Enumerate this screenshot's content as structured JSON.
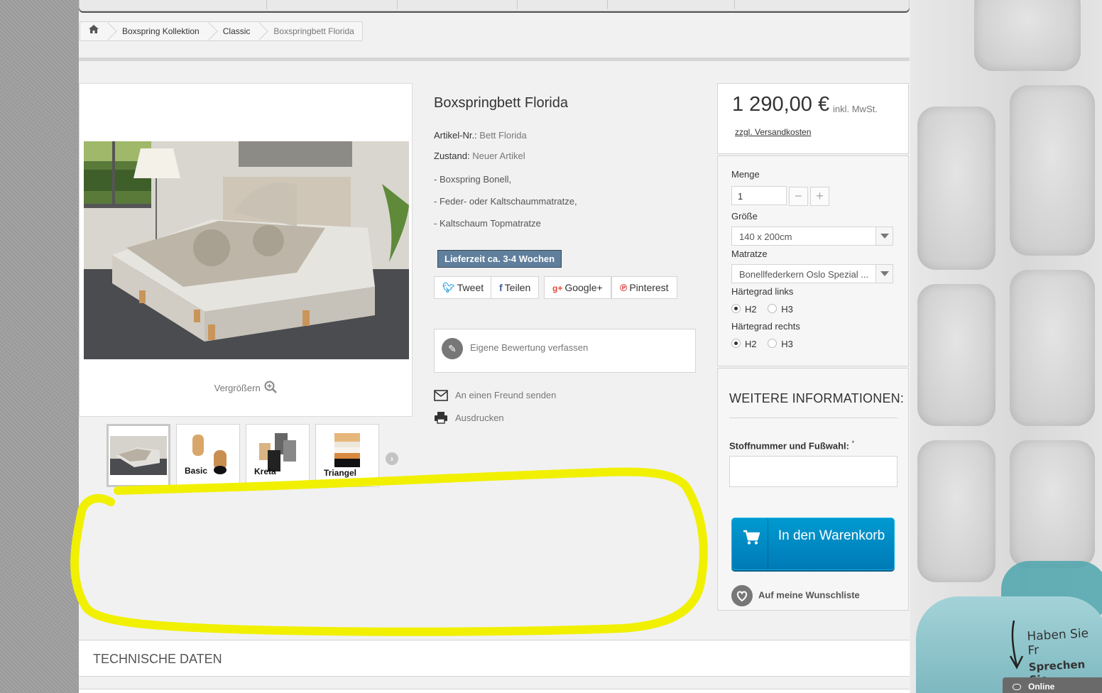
{
  "breadcrumb": {
    "home_icon": "home-icon",
    "items": [
      "Boxspring Kollektion",
      "Classic",
      "Boxspringbett Florida"
    ]
  },
  "product": {
    "title": "Boxspringbett Florida",
    "reference_label": "Artikel-Nr.:",
    "reference_value": "Bett Florida",
    "condition_label": "Zustand:",
    "condition_value": "Neuer Artikel",
    "features": [
      "- Boxspring Bonell,",
      "- Feder- oder Kaltschaummatratze,",
      "- Kaltschaum Topmatratze"
    ],
    "availability": "Lieferzeit ca. 3-4 Wochen",
    "enlarge_label": "Vergrößern"
  },
  "thumbnails": [
    {
      "label": ""
    },
    {
      "label": "Basic"
    },
    {
      "label": "Kreta"
    },
    {
      "label": "Triangel"
    }
  ],
  "social": {
    "tweet": "Tweet",
    "share": "Teilen",
    "googleplus": "Google+",
    "pinterest": "Pinterest"
  },
  "review": {
    "label": "Eigene Bewertung verfassen"
  },
  "actions": {
    "send_friend": "An einen Freund senden",
    "print": "Ausdrucken"
  },
  "pricing": {
    "price": "1 290,00 €",
    "tax_label": "inkl. MwSt.",
    "shipping_link": "zzgl. Versandkosten"
  },
  "options": {
    "quantity_label": "Menge",
    "quantity_value": "1",
    "minus": "−",
    "plus": "+",
    "size_label": "Größe",
    "size_value": "140 x 200cm",
    "mattress_label": "Matratze",
    "mattress_value": "Bonellfederkern Oslo Spezial ...",
    "hardness_left_label": "Härtegrad links",
    "hardness_right_label": "Härtegrad rechts",
    "hardness_options": [
      "H2",
      "H3"
    ],
    "hardness_left_selected": "H2",
    "hardness_right_selected": "H2"
  },
  "more_info": {
    "title": "WEITERE INFORMATIONEN:",
    "custom_label": "Stoffnummer und Fußwahl:",
    "required_mark": "*",
    "add_to_cart": "In den Warenkorb",
    "wishlist": "Auf meine Wunschliste"
  },
  "tech": {
    "title": "TECHNISCHE DATEN"
  },
  "chat": {
    "line1": "Haben Sie Fr",
    "line2": "Sprechen Sie",
    "status": "Online"
  },
  "colors": {
    "accent_blue": "#0088c8",
    "availability_bg": "#5f7f9c",
    "highlight": "#f0f000"
  }
}
